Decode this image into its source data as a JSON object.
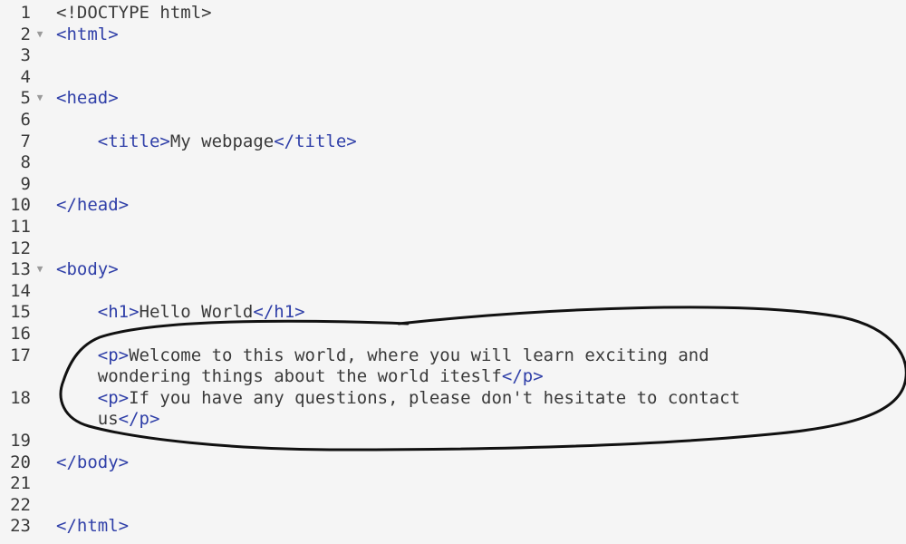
{
  "editor": {
    "lines": [
      {
        "num": "1",
        "parts": [
          {
            "t": "txt",
            "v": "<!DOCTYPE html>"
          }
        ]
      },
      {
        "num": "2",
        "fold": true,
        "parts": [
          {
            "t": "tag",
            "v": "<html>"
          }
        ]
      },
      {
        "num": "3",
        "parts": []
      },
      {
        "num": "4",
        "parts": []
      },
      {
        "num": "5",
        "fold": true,
        "parts": [
          {
            "t": "tag",
            "v": "<head>"
          }
        ]
      },
      {
        "num": "6",
        "parts": []
      },
      {
        "num": "7",
        "parts": [
          {
            "t": "txt",
            "v": "    "
          },
          {
            "t": "tag",
            "v": "<title>"
          },
          {
            "t": "txt",
            "v": "My webpage"
          },
          {
            "t": "tag",
            "v": "</title>"
          }
        ]
      },
      {
        "num": "8",
        "parts": []
      },
      {
        "num": "9",
        "parts": []
      },
      {
        "num": "10",
        "parts": [
          {
            "t": "tag",
            "v": "</head>"
          }
        ]
      },
      {
        "num": "11",
        "parts": []
      },
      {
        "num": "12",
        "parts": []
      },
      {
        "num": "13",
        "fold": true,
        "parts": [
          {
            "t": "tag",
            "v": "<body>"
          }
        ]
      },
      {
        "num": "14",
        "parts": []
      },
      {
        "num": "15",
        "parts": [
          {
            "t": "txt",
            "v": "    "
          },
          {
            "t": "tag",
            "v": "<h1>"
          },
          {
            "t": "txt",
            "v": "Hello World"
          },
          {
            "t": "tag",
            "v": "</h1>"
          }
        ]
      },
      {
        "num": "16",
        "parts": []
      },
      {
        "num": "17",
        "parts": [
          {
            "t": "txt",
            "v": "    "
          },
          {
            "t": "tag",
            "v": "<p>"
          },
          {
            "t": "txt",
            "v": "Welcome to this world, where you will learn exciting and"
          }
        ]
      },
      {
        "num": "",
        "parts": [
          {
            "t": "txt",
            "v": "    wondering things about the world iteslf"
          },
          {
            "t": "tag",
            "v": "</p>"
          }
        ]
      },
      {
        "num": "18",
        "parts": [
          {
            "t": "txt",
            "v": "    "
          },
          {
            "t": "tag",
            "v": "<p>"
          },
          {
            "t": "txt",
            "v": "If you have any questions, please don't hesitate to contact"
          }
        ]
      },
      {
        "num": "",
        "parts": [
          {
            "t": "txt",
            "v": "    us"
          },
          {
            "t": "tag",
            "v": "</p>"
          }
        ]
      },
      {
        "num": "19",
        "parts": []
      },
      {
        "num": "20",
        "parts": [
          {
            "t": "tag",
            "v": "</body>"
          }
        ]
      },
      {
        "num": "21",
        "parts": []
      },
      {
        "num": "22",
        "parts": []
      },
      {
        "num": "23",
        "parts": [
          {
            "t": "tag",
            "v": "</html>"
          }
        ]
      }
    ]
  },
  "colors": {
    "background": "#f5f5f5",
    "tag": "#2f3fa8",
    "text": "#3a3a3a",
    "annotation_stroke": "#111111"
  },
  "icons": {
    "fold_marker": "triangle-down-icon"
  }
}
